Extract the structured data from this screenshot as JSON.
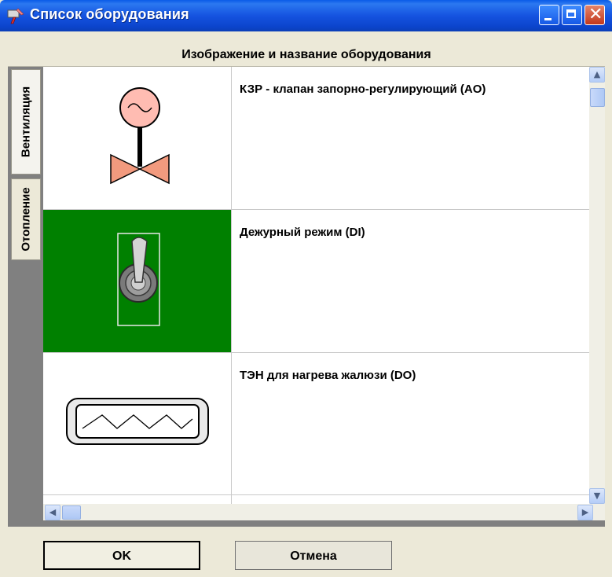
{
  "window": {
    "title": "Список оборудования"
  },
  "header": {
    "column_title": "Изображение и название оборудования"
  },
  "tabs": [
    {
      "label": "Вентиляция"
    },
    {
      "label": "Отопление"
    }
  ],
  "rows": [
    {
      "name": "КЗР - клапан запорно-регулирующий (AO)",
      "icon": "valve-actuator-icon"
    },
    {
      "name": "Дежурный режим (DI)",
      "icon": "toggle-switch-icon"
    },
    {
      "name": "ТЭН для нагрева жалюзи (DO)",
      "icon": "heating-element-icon"
    }
  ],
  "buttons": {
    "ok": "OK",
    "cancel": "Отмена"
  },
  "colors": {
    "title_bar": "#0b44cc",
    "selected_row": "#008000",
    "window_bg": "#ece9d8"
  }
}
